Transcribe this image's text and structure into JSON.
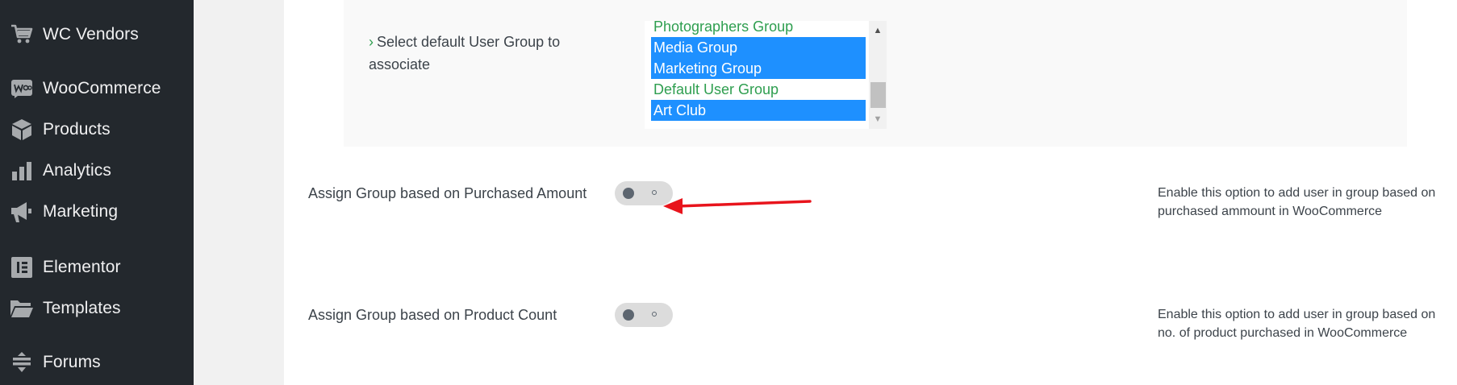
{
  "sidebar": {
    "items": [
      {
        "label": "WC Vendors",
        "icon": "cart-icon"
      },
      {
        "label": "WooCommerce",
        "icon": "woo-icon"
      },
      {
        "label": "Products",
        "icon": "box-icon"
      },
      {
        "label": "Analytics",
        "icon": "bar-chart-icon"
      },
      {
        "label": "Marketing",
        "icon": "megaphone-icon"
      },
      {
        "label": "Elementor",
        "icon": "elementor-icon"
      },
      {
        "label": "Templates",
        "icon": "folder-icon"
      },
      {
        "label": "Forums",
        "icon": "forums-icon"
      }
    ]
  },
  "group_select": {
    "label": "Select default User Group to associate",
    "chevron": "›",
    "options": [
      {
        "label": "Photographers Group",
        "selected": false
      },
      {
        "label": "Media Group",
        "selected": true
      },
      {
        "label": "Marketing Group",
        "selected": true
      },
      {
        "label": "Default User Group",
        "selected": false
      },
      {
        "label": "Art Club",
        "selected": true
      }
    ]
  },
  "settings": [
    {
      "label": "Assign Group based on Purchased Amount",
      "enabled": false,
      "description": "Enable this option to add user in group based on purchased ammount in WooCommerce"
    },
    {
      "label": "Assign Group based on Product Count",
      "enabled": false,
      "description": "Enable this option to add user in group based on no. of product purchased in WooCommerce"
    }
  ],
  "colors": {
    "sidebar_bg": "#23282d",
    "accent_green": "#2e9e4f",
    "selected_blue": "#1e90ff",
    "annotation_arrow": "#e8141c"
  }
}
